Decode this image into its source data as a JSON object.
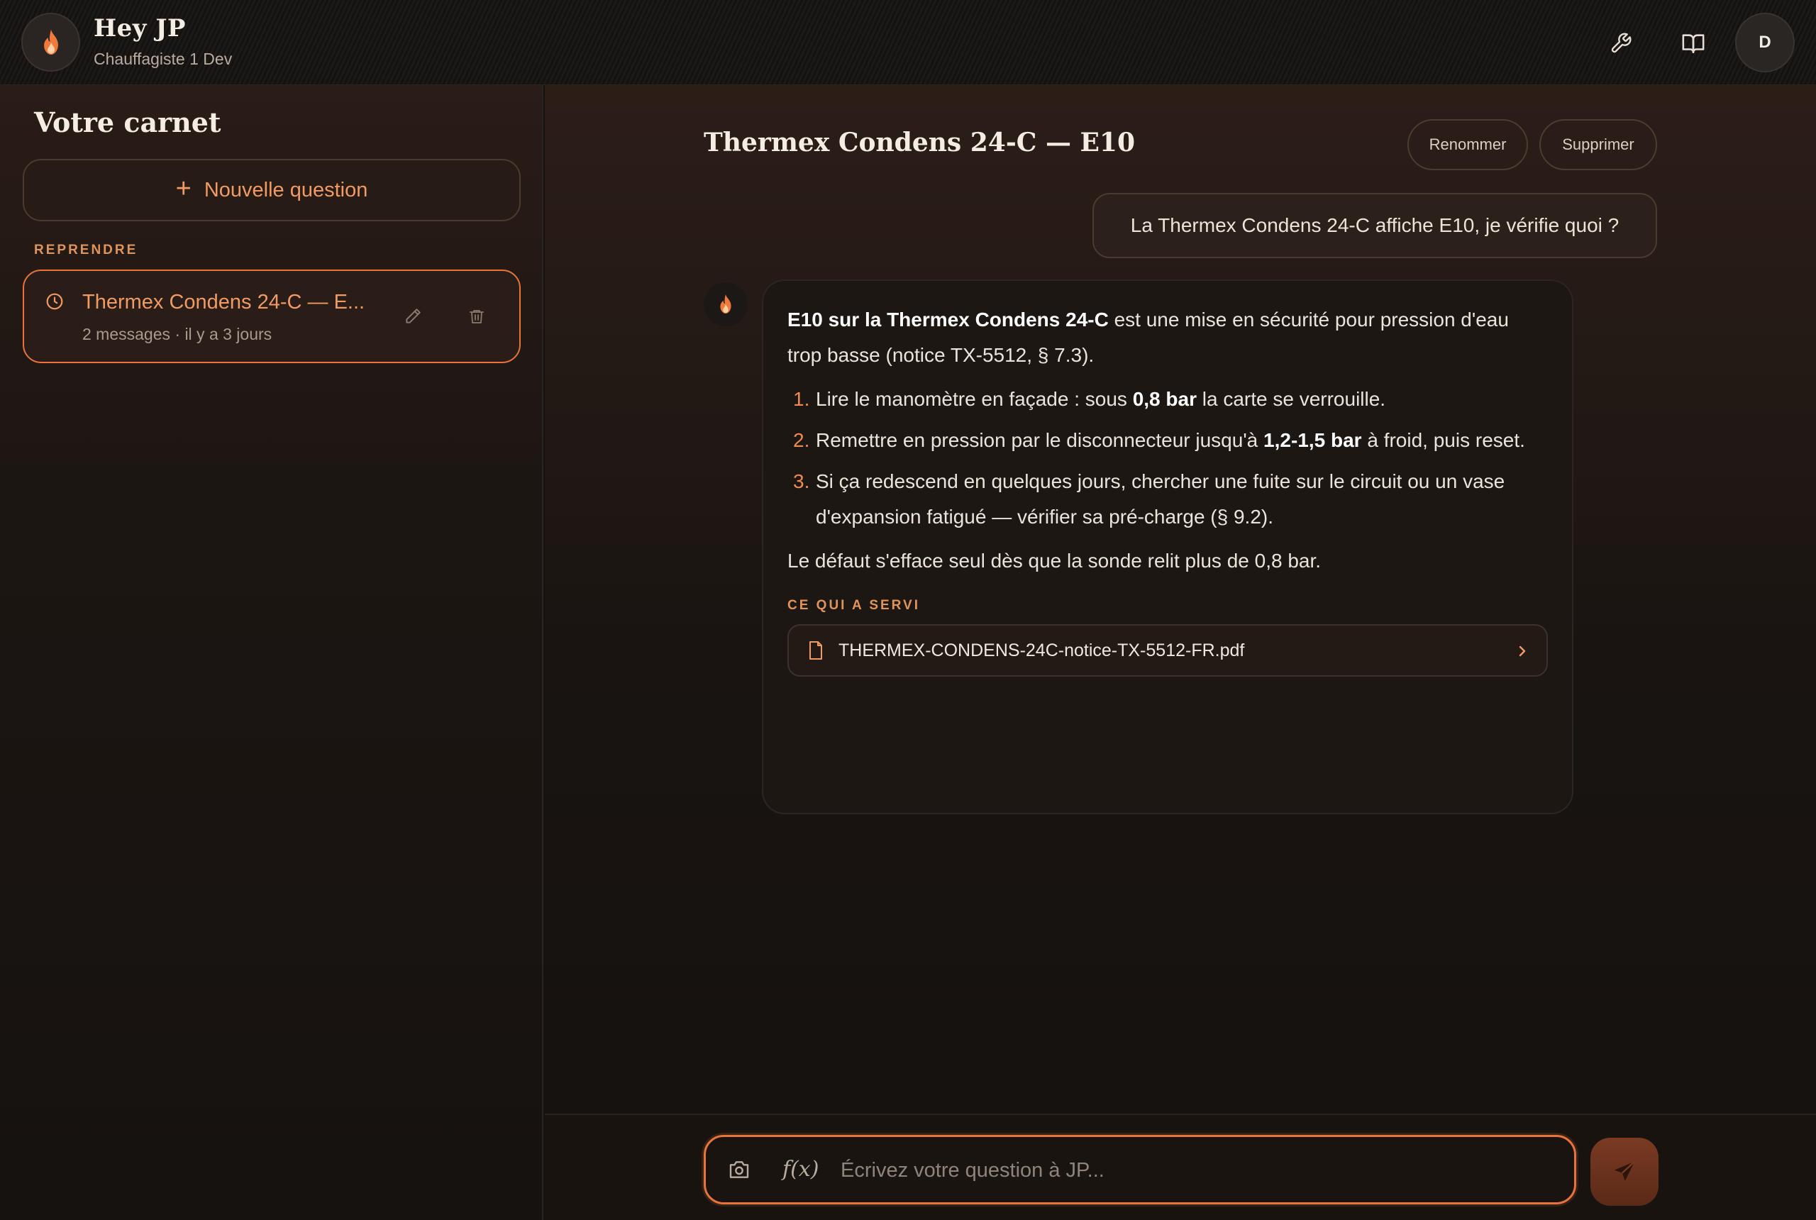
{
  "header": {
    "title": "Hey JP",
    "subtitle": "Chauffagiste 1 Dev",
    "logo_icon": "flame-icon",
    "actions": [
      "wrench-icon",
      "book-icon"
    ],
    "avatar_initial": "D"
  },
  "sidebar": {
    "title": "Votre carnet",
    "new_question_label": "Nouvelle question",
    "section_label": "REPRENDRE",
    "conversations": [
      {
        "title": "Thermex Condens 24-C — E...",
        "meta": "2 messages · il y a 3 jours"
      }
    ]
  },
  "conversation": {
    "title": "Thermex Condens 24-C — E10",
    "rename_label": "Renommer",
    "delete_label": "Supprimer",
    "user_message": "La Thermex Condens 24-C affiche E10, je vérifie quoi ?",
    "answer": {
      "intro_bold": "E10 sur la Thermex Condens 24-C",
      "intro_rest": " est une mise en sécurité pour pression d'eau trop basse (notice TX-5512, § 7.3).",
      "steps": [
        {
          "num": "1.",
          "pre": "Lire le manomètre en façade : sous ",
          "bold": "0,8 bar",
          "post": " la carte se verrouille."
        },
        {
          "num": "2.",
          "pre": "Remettre en pression par le disconnecteur jusqu'à ",
          "bold": "1,2-1,5 bar",
          "post": " à froid, puis reset."
        },
        {
          "num": "3.",
          "pre": "Si ça redescend en quelques jours, chercher une fuite sur le circuit ou un vase d'expansion fatigué — vérifier sa pré-charge (§ 9.2).",
          "bold": "",
          "post": ""
        }
      ],
      "outro": "Le défaut s'efface seul dès que la sonde relit plus de 0,8 bar.",
      "sources_label": "CE QUI A SERVI",
      "sources": [
        {
          "filename": "THERMEX-CONDENS-24C-notice-TX-5512-FR.pdf"
        }
      ]
    }
  },
  "composer": {
    "placeholder": "Écrivez votre question à JP...",
    "fx_label": "f(x)"
  },
  "colors": {
    "accent": "#e8743c",
    "accent_text": "#f09a64",
    "background": "#161210"
  }
}
